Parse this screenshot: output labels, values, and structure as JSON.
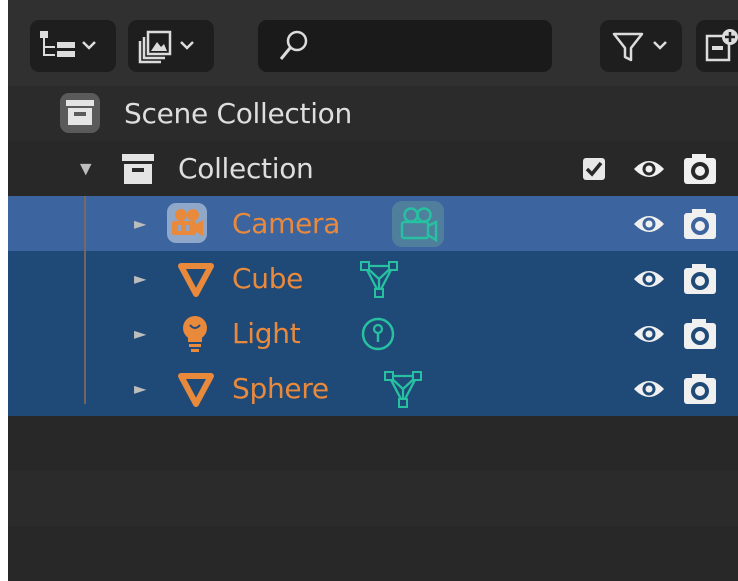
{
  "header": {
    "display_mode_icon": "outliner-tree-icon",
    "view_layer_icon": "image-stack-icon",
    "search_icon": "magnifier-icon",
    "search_value": "",
    "filter_icon": "funnel-icon",
    "new_collection_icon": "new-collection-icon"
  },
  "tree": {
    "scene_collection": {
      "label": "Scene Collection",
      "icon": "collection-box-icon"
    },
    "collection": {
      "label": "Collection",
      "expanded": true,
      "checked": true,
      "visible": true,
      "renderable": true
    },
    "objects": [
      {
        "label": "Camera",
        "icon": "camera-icon",
        "data_icon": "camera-data-icon",
        "selected": true,
        "active": true
      },
      {
        "label": "Cube",
        "icon": "mesh-icon",
        "data_icon": "mesh-data-icon",
        "selected": true,
        "active": false
      },
      {
        "label": "Light",
        "icon": "light-bulb-icon",
        "data_icon": "light-data-icon",
        "selected": true,
        "active": false
      },
      {
        "label": "Sphere",
        "icon": "mesh-icon",
        "data_icon": "mesh-data-icon",
        "selected": true,
        "active": false
      }
    ]
  },
  "colors": {
    "panel_bg": "#282828",
    "header_bg": "#303030",
    "selected_row": "#1f4a78",
    "active_row": "#3c649e",
    "object_text": "#e8893c",
    "data_icon": "#27c0a0",
    "text": "#dedede"
  }
}
